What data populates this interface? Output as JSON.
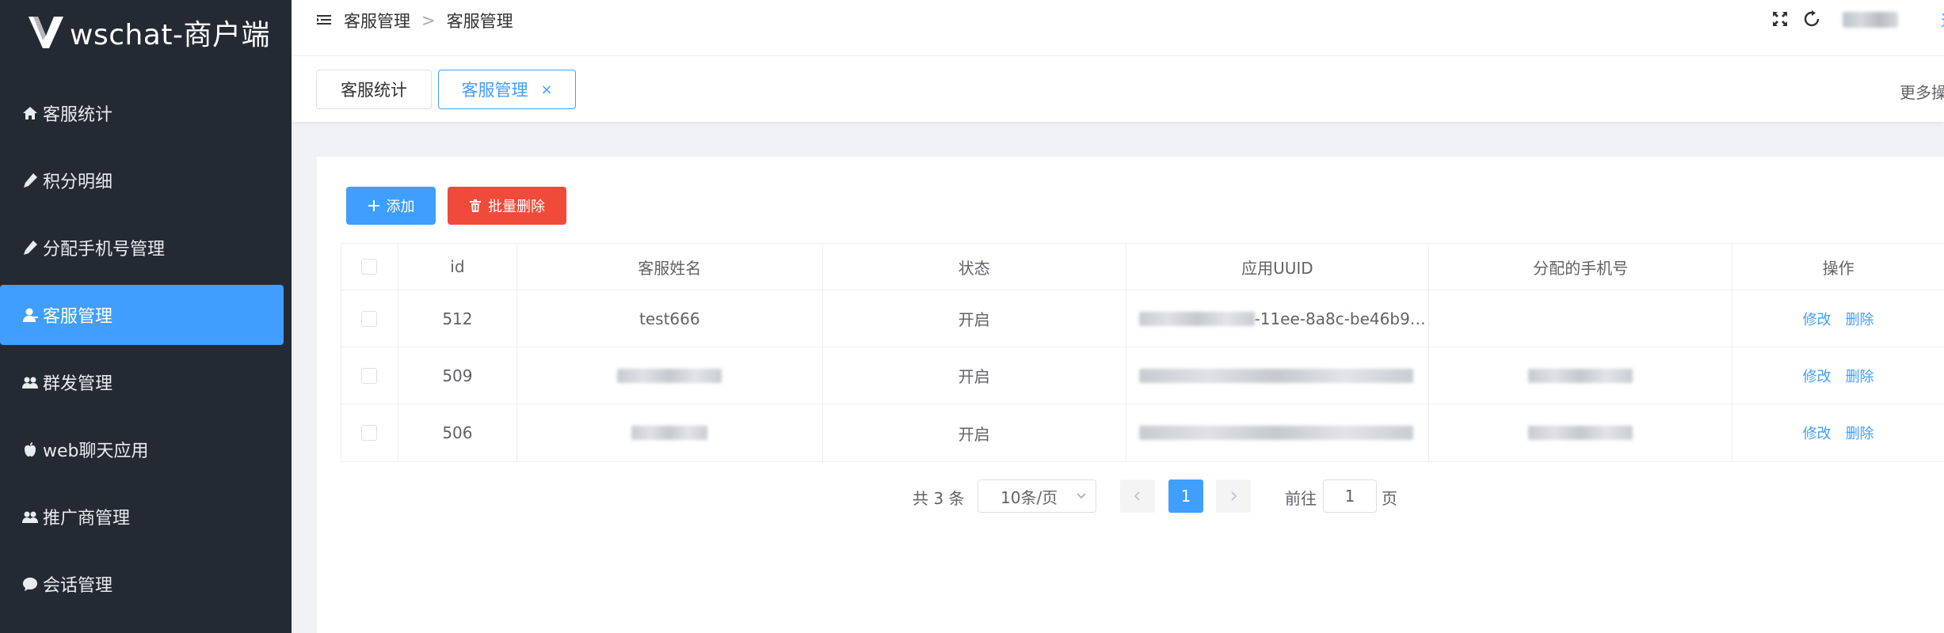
{
  "app": {
    "title": "wschat-商户端",
    "accent": "#409eff",
    "sidebar_bg": "#242a33",
    "danger": "#f04a3a"
  },
  "sidebar": {
    "items": [
      {
        "label": "客服统计",
        "icon": "home-icon"
      },
      {
        "label": "积分明细",
        "icon": "pencil-icon"
      },
      {
        "label": "分配手机号管理",
        "icon": "pencil-icon"
      },
      {
        "label": "客服管理",
        "icon": "user-icon",
        "active": true
      },
      {
        "label": "群发管理",
        "icon": "users-icon"
      },
      {
        "label": "web聊天应用",
        "icon": "apple-icon"
      },
      {
        "label": "推广商管理",
        "icon": "users-icon"
      },
      {
        "label": "会话管理",
        "icon": "chat-icon"
      }
    ]
  },
  "header": {
    "breadcrumb": [
      "客服管理",
      "客服管理"
    ],
    "separator": ">",
    "edge_link": "退"
  },
  "tabs": [
    {
      "label": "客服统计",
      "active": false
    },
    {
      "label": "客服管理",
      "active": true,
      "close": "×"
    }
  ],
  "more_ops": "更多操作",
  "toolbar": {
    "add_label": "添加",
    "batch_delete_label": "批量删除"
  },
  "table": {
    "columns": [
      "id",
      "客服姓名",
      "状态",
      "应用UUID",
      "分配的手机号",
      "操作"
    ],
    "rows": [
      {
        "id": "512",
        "name": "test666",
        "status": "开启",
        "uuid_visible": "-11ee-8a8c-be46b9…",
        "phone": ""
      },
      {
        "id": "509",
        "name": "",
        "status": "开启",
        "uuid_visible": "",
        "phone": ""
      },
      {
        "id": "506",
        "name": "",
        "status": "开启",
        "uuid_visible": "",
        "phone": ""
      }
    ],
    "actions": {
      "edit": "修改",
      "delete": "删除"
    }
  },
  "pagination": {
    "total_label": "共 3 条",
    "page_size": "10条/页",
    "current_page": "1",
    "goto_label": "前往",
    "goto_value": "1",
    "page_suffix": "页"
  }
}
